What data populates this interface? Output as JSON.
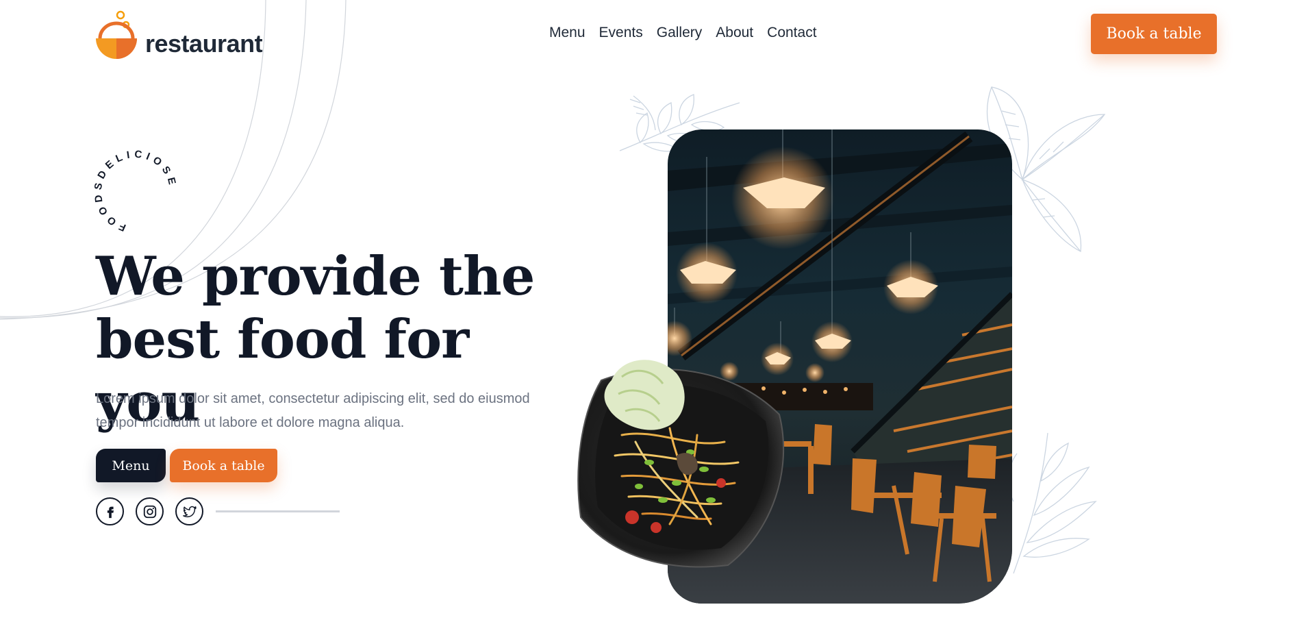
{
  "brand": {
    "name": "restaurant",
    "accent_color": "#e8702a",
    "dark_color": "#111827",
    "logo_icon": "bowl-logo-icon"
  },
  "nav": {
    "items": [
      "Menu",
      "Events",
      "Gallery",
      "About",
      "Contact"
    ]
  },
  "header": {
    "cta_label": "Book a table"
  },
  "hero": {
    "circular_text": "FOODSDELICIOSE",
    "title_line1": "We provide the",
    "title_line2": "best food for you",
    "description": "Lorem ipsum dolor sit amet, consectetur adipiscing elit, sed do eiusmod tempor incididunt ut labore et dolore magna aliqua.",
    "primary_button": "Menu",
    "secondary_button": "Book a table"
  },
  "socials": [
    {
      "name": "facebook",
      "icon": "facebook-icon"
    },
    {
      "name": "instagram",
      "icon": "instagram-icon"
    },
    {
      "name": "twitter",
      "icon": "twitter-icon"
    }
  ],
  "images": {
    "main_photo": "restaurant-interior-photo",
    "side_photo": "salad-plate-photo"
  }
}
